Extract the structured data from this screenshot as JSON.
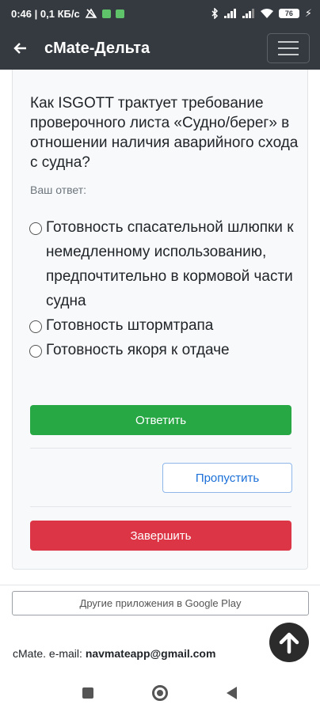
{
  "status_bar": {
    "time_speed": "0:46 | 0,1 КБ/с",
    "battery": "76"
  },
  "app_bar": {
    "title": "cMate-Дельта",
    "back_icon": "arrow-left-icon",
    "menu_icon": "hamburger-menu-icon"
  },
  "quiz": {
    "question": "Как ISGOTT трактует требование проверочного листа «Судно/берег» в отношении наличия аварийного схода с судна?",
    "your_answer_label": "Ваш ответ:",
    "options": [
      {
        "label": "Готовность спасательной шлюпки к немедленному использованию, предпочтительно в кормовой части судна"
      },
      {
        "label": "Готовность штормтрапа"
      },
      {
        "label": "Готовность якоря к отдаче"
      }
    ],
    "answer_button": "Ответить",
    "skip_button": "Пропустить",
    "finish_button": "Завершить"
  },
  "footer": {
    "play_button": "Другие приложения в Google Play",
    "contact_prefix": "cMate. e-mail: ",
    "contact_email": "navmateapp@gmail.com"
  },
  "colors": {
    "bar": "#343a40",
    "success": "#28a745",
    "danger": "#dc3545",
    "primary": "#1a6fd8"
  }
}
